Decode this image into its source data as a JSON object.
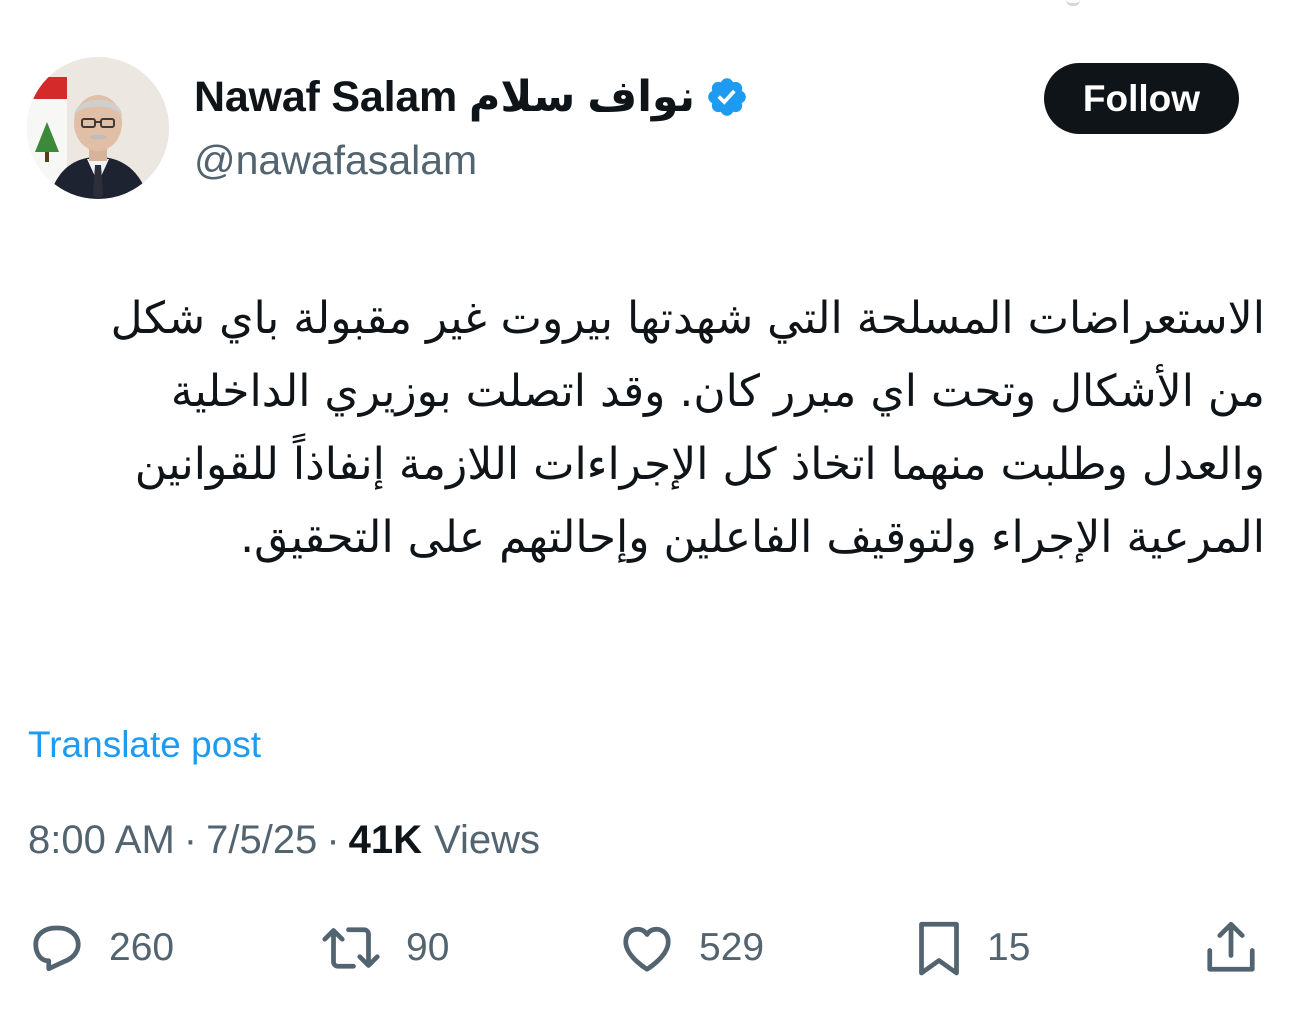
{
  "user": {
    "display_name": "Nawaf Salam نواف سلام",
    "handle": "@nawafasalam",
    "verified_icon": "verified-badge-icon",
    "verified_color": "#1d9bf0"
  },
  "follow_label": "Follow",
  "post": {
    "text": "الاستعراضات المسلحة التي شهدتها بيروت غير مقبولة باي شكل من الأشكال وتحت اي مبرر كان. وقد اتصلت بوزيري الداخلية والعدل وطلبت منهما اتخاذ كل الإجراءات اللازمة إنفاذاً للقوانين المرعية الإجراء ولتوقيف الفاعلين وإحالتهم على التحقيق.",
    "translate_label": "Translate post"
  },
  "meta": {
    "time": "8:00 AM",
    "separator": "·",
    "date": "7/5/25",
    "views_count": "41K",
    "views_label": "Views"
  },
  "actions": {
    "replies": "260",
    "reposts": "90",
    "likes": "529",
    "bookmarks": "15"
  },
  "colors": {
    "text": "#0f1419",
    "muted": "#536471",
    "link": "#1d9bf0",
    "button_bg": "#0f1419",
    "button_text": "#ffffff"
  }
}
